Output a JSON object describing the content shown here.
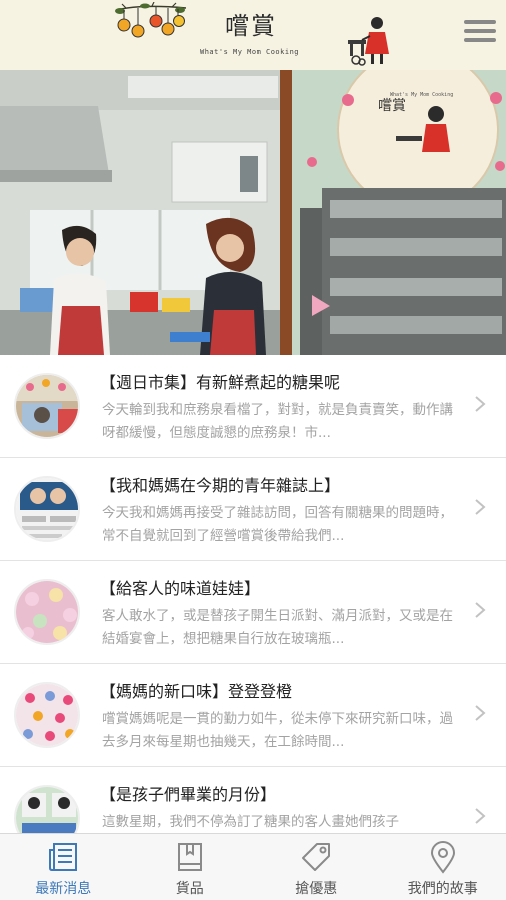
{
  "header": {
    "title": "嚐賞",
    "subtitle": "What's My Mom Cooking"
  },
  "hero": {
    "wall_sign_title": "嚐賞",
    "wall_sign_subtitle": "What's My Mom Cooking"
  },
  "news": [
    {
      "title": "【週日市集】有新鮮煮起的糖果呢",
      "excerpt": "今天輪到我和庶務泉看檔了，對對，就是負責賣笑，動作講呀都緩慢，但態度誠懇的庶務泉！市..."
    },
    {
      "title": "【我和媽媽在今期的青年雜誌上】",
      "excerpt": "今天我和媽媽再接受了雜誌訪問，回答有關糖果的問題時，常不自覺就回到了經營嚐賞後帶給我們..."
    },
    {
      "title": "【給客人的味道娃娃】",
      "excerpt": "客人敢水了，或是替孩子開生日派對、滿月派對，又或是在結婚宴會上，想把糖果自行放在玻璃瓶..."
    },
    {
      "title": "【媽媽的新口味】登登登橙",
      "excerpt": "嚐賞媽媽呢是一貫的勤力如牛，從未停下來研究新口味，過去多月來每星期也抽幾天，在工餘時間..."
    },
    {
      "title": "【是孩子們畢業的月份】",
      "excerpt": "這數星期，我們不停為訂了糖果的客人畫她們孩子"
    }
  ],
  "tabs": [
    {
      "label": "最新消息",
      "icon": "news-icon"
    },
    {
      "label": "貨品",
      "icon": "book-icon"
    },
    {
      "label": "搶優惠",
      "icon": "tag-icon"
    },
    {
      "label": "我們的故事",
      "icon": "location-pin-icon"
    }
  ],
  "colors": {
    "header_bg": "#f6f3e3",
    "active_tab": "#3d78b9",
    "excerpt_text": "#a3a3a3"
  }
}
